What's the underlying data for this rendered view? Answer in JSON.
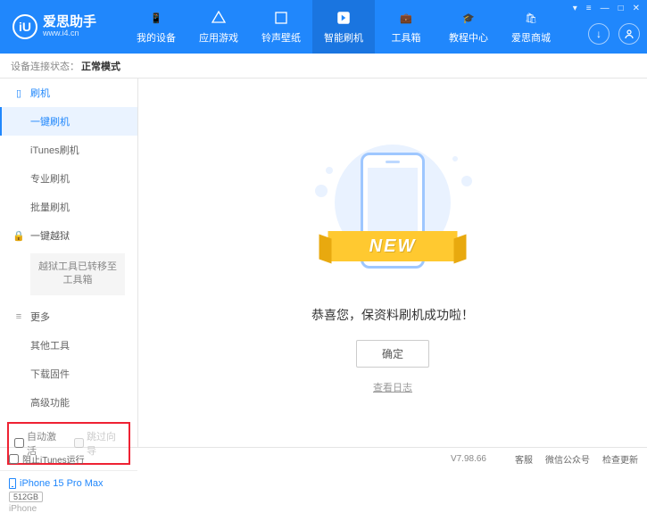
{
  "header": {
    "logo_letter": "iU",
    "logo_title": "爱思助手",
    "logo_url": "www.i4.cn",
    "nav": [
      {
        "label": "我的设备"
      },
      {
        "label": "应用游戏"
      },
      {
        "label": "铃声壁纸"
      },
      {
        "label": "智能刷机"
      },
      {
        "label": "工具箱"
      },
      {
        "label": "教程中心"
      },
      {
        "label": "爱思商城"
      }
    ]
  },
  "status": {
    "label": "设备连接状态：",
    "value": "正常模式"
  },
  "sidebar": {
    "flash_header": "刷机",
    "flash_items": [
      "一键刷机",
      "iTunes刷机",
      "专业刷机",
      "批量刷机"
    ],
    "jailbreak_header": "一键越狱",
    "jailbreak_block": "越狱工具已转移至工具箱",
    "more_header": "更多",
    "more_items": [
      "其他工具",
      "下载固件",
      "高级功能"
    ],
    "checkbox1": "自动激活",
    "checkbox2": "跳过向导"
  },
  "device": {
    "name": "iPhone 15 Pro Max",
    "storage": "512GB",
    "type": "iPhone"
  },
  "main": {
    "ribbon": "NEW",
    "message": "恭喜您，保资料刷机成功啦！",
    "confirm": "确定",
    "log_link": "查看日志"
  },
  "footer": {
    "block_itunes": "阻止iTunes运行",
    "version": "V7.98.66",
    "links": [
      "客服",
      "微信公众号",
      "检查更新"
    ]
  }
}
